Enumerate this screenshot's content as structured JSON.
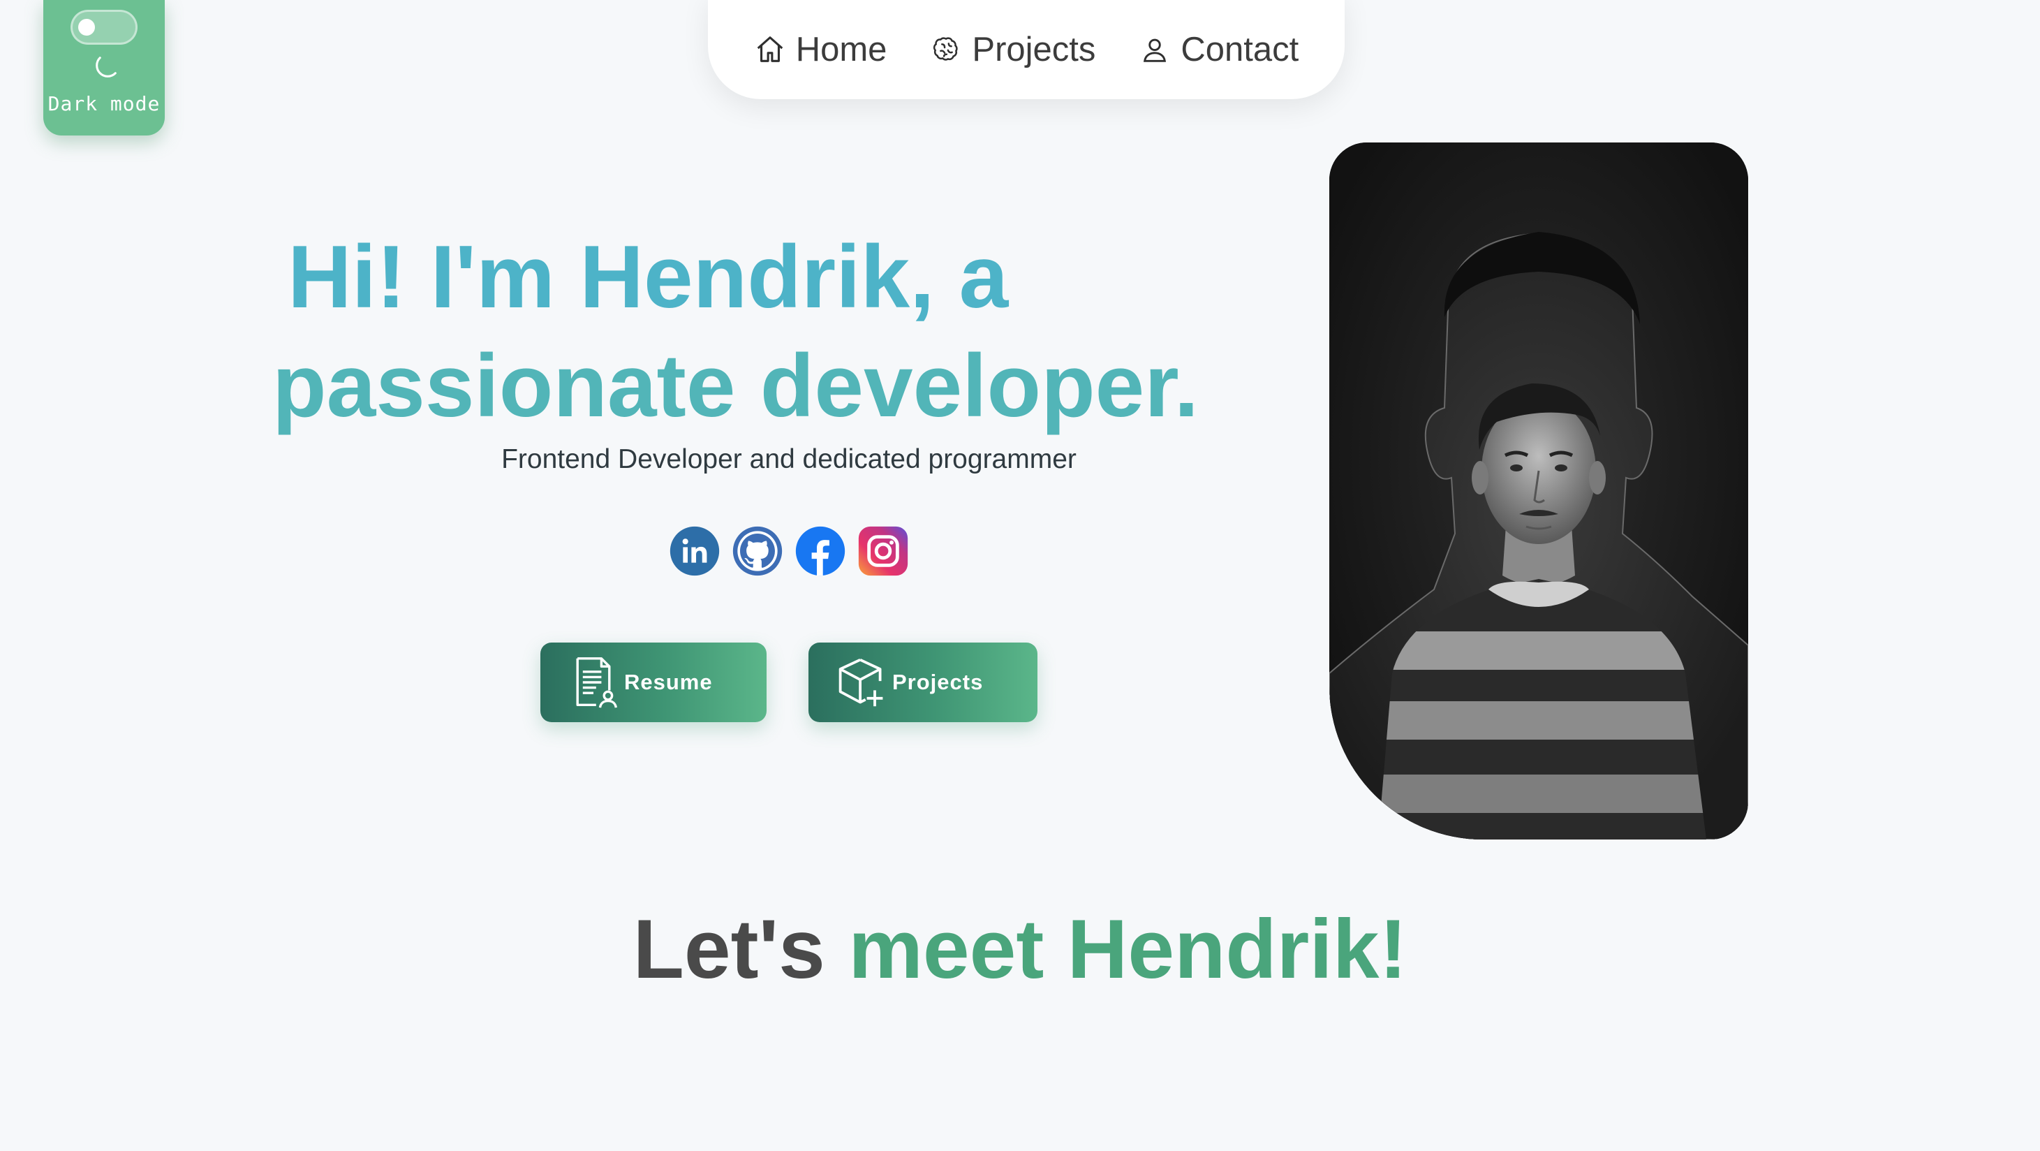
{
  "dark_mode": {
    "label": "Dark mode"
  },
  "nav": {
    "items": [
      {
        "label": "Home",
        "icon": "home-icon"
      },
      {
        "label": "Projects",
        "icon": "brain-icon"
      },
      {
        "label": "Contact",
        "icon": "user-icon"
      }
    ]
  },
  "hero": {
    "title_line1": "Hi! I'm Hendrik, a",
    "title_line2": "passionate developer.",
    "subtitle": "Frontend Developer and dedicated programmer"
  },
  "socials": [
    "linkedin-icon",
    "github-icon",
    "facebook-icon",
    "instagram-icon"
  ],
  "buttons": {
    "resume": "Resume",
    "projects": "Projects"
  },
  "meet": {
    "prefix": "Let's",
    "accent": "meet Hendrik!"
  },
  "colors": {
    "accent_green": "#6cc092",
    "title_teal": "#4db3c8",
    "meet_green": "#4aa57c",
    "button_dark": "#2b6f5e"
  }
}
